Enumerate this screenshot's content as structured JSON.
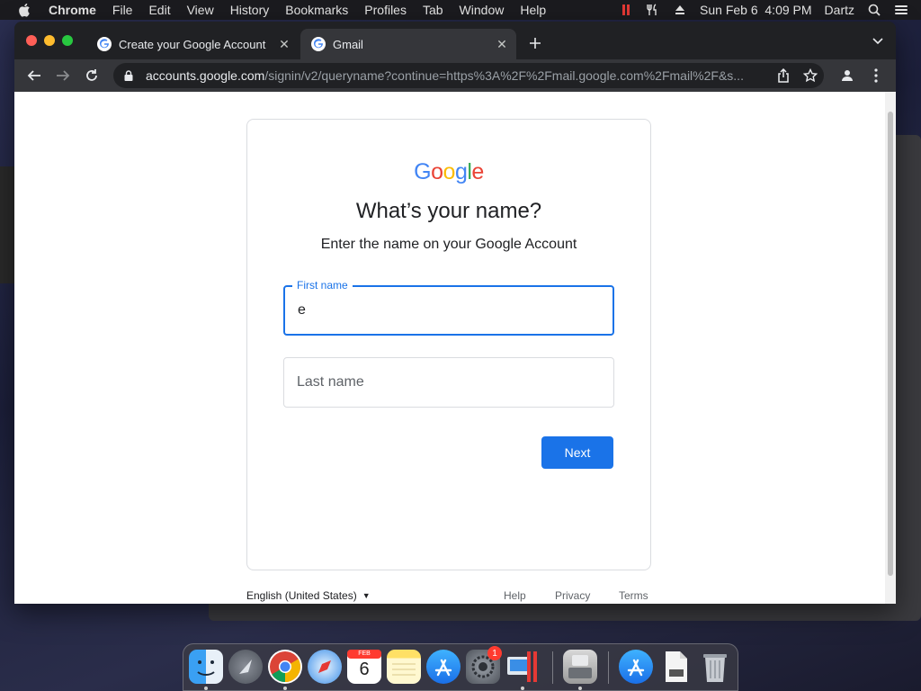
{
  "menubar": {
    "app_name": "Chrome",
    "items": [
      "File",
      "Edit",
      "View",
      "History",
      "Bookmarks",
      "Profiles",
      "Tab",
      "Window",
      "Help"
    ],
    "clock": "Sun Feb 6  4:09 PM",
    "user": "Dartz",
    "icons": [
      "apple-icon",
      "parallels-icon",
      "utensils-icon",
      "eject-icon",
      "spotlight-icon",
      "control-center-icon"
    ]
  },
  "browser": {
    "tabs": [
      {
        "title": "Create your Google Account",
        "active": false
      },
      {
        "title": "Gmail",
        "active": true
      }
    ],
    "address": {
      "host": "accounts.google.com",
      "path": "/signin/v2/queryname?continue=https%3A%2F%2Fmail.google.com%2Fmail%2F&s..."
    }
  },
  "page": {
    "logo": {
      "letters": [
        "G",
        "o",
        "o",
        "g",
        "l",
        "e"
      ],
      "colors": [
        "#4285F4",
        "#EA4335",
        "#FBBC05",
        "#4285F4",
        "#34A853",
        "#EA4335"
      ]
    },
    "heading": "What’s your name?",
    "subheading": "Enter the name on your Google Account",
    "first_name": {
      "label": "First name",
      "value": "e"
    },
    "last_name": {
      "placeholder": "Last name",
      "value": ""
    },
    "next_label": "Next",
    "accent": "#1a73e8"
  },
  "footer": {
    "language": "English (United States)",
    "links": [
      "Help",
      "Privacy",
      "Terms"
    ]
  },
  "dock": {
    "apps": [
      "finder-icon",
      "launchpad-icon",
      "chrome-icon",
      "safari-icon",
      "calendar-icon",
      "notes-icon",
      "app-store-icon",
      "system-preferences-icon",
      "parallels-desktop-icon",
      "disk-utility-icon",
      "app-store-downloads-icon",
      "document-icon",
      "trash-icon"
    ],
    "calendar_month": "FEB",
    "calendar_day": "6",
    "sysprefs_badge": "1"
  }
}
